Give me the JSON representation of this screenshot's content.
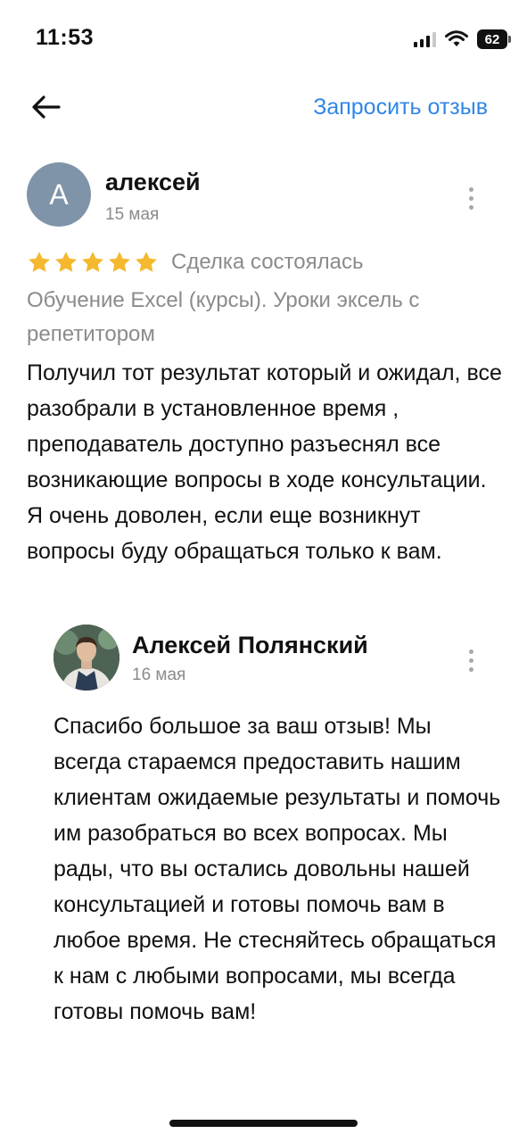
{
  "status_bar": {
    "time": "11:53",
    "battery": "62",
    "icons": [
      "signal-icon",
      "wifi-icon",
      "battery-icon"
    ]
  },
  "nav": {
    "back_icon": "arrow-left-icon",
    "request_review": "Запросить отзыв",
    "accent_color": "#2f86e8"
  },
  "review": {
    "avatar_letter": "А",
    "author": "алексей",
    "date": "15 мая",
    "rating": 5,
    "rating_max": 5,
    "star_color": "#f5b82e",
    "deal_status": "Сделка состоялась",
    "service": "Обучение Excel (курсы). Уроки эксель с репетитором",
    "text": "Получил тот результат который и ожидал, все разобрали в установленное время , преподаватель доступно разъеснял все возникающие вопросы в ходе консультации. Я очень доволен, если еще возникнут вопросы буду обращаться только к вам."
  },
  "reply": {
    "author": "Алексей Полянский",
    "date": "16 мая",
    "text": "Спасибо большое за ваш отзыв! Мы всегда стараемся предоставить нашим клиентам ожидаемые результаты и помочь им разобраться во всех вопросах. Мы рады, что вы остались довольны нашей консультацией и готовы помочь вам в любое время. Не стесняйтесь обращаться к нам с любыми вопросами, мы всегда готовы помочь вам!"
  }
}
